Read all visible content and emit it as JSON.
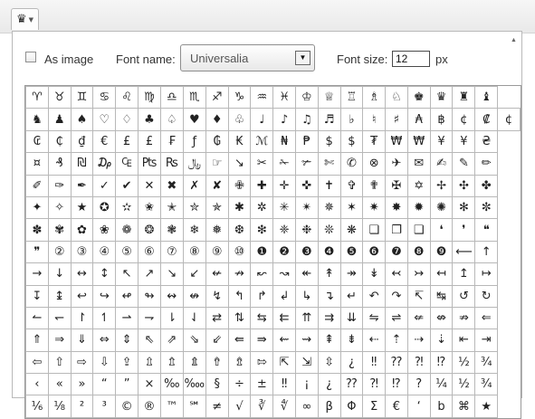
{
  "toolbar": {
    "special_char_icon": "♛",
    "dropdown_caret": "▼"
  },
  "panel": {
    "as_image_label": "As image",
    "font_name_label": "Font name:",
    "font_name_value": "Universalia",
    "font_size_label": "Font size:",
    "font_size_value": "12",
    "px_label": "px",
    "select_arrow": "▼",
    "scroll_up": "▲",
    "scroll_down": "▼"
  },
  "characters": [
    [
      "♈",
      "♉",
      "♊",
      "♋",
      "♌",
      "♍",
      "♎",
      "♏",
      "♐",
      "♑",
      "♒",
      "♓",
      "♔",
      "♕",
      "♖",
      "♗",
      "♘",
      "♚",
      "♛",
      "♜",
      "♝"
    ],
    [
      "♞",
      "♟",
      "♠",
      "♡",
      "♢",
      "♣",
      "♤",
      "♥",
      "♦",
      "♧",
      "♩",
      "♪",
      "♫",
      "♬",
      "♭",
      "♮",
      "♯",
      "₳",
      "฿",
      "¢",
      "₡",
      "¢"
    ],
    [
      "₢",
      "₵",
      "₫",
      "€",
      "£",
      "£",
      "₣",
      "ƒ",
      "₲",
      "₭",
      "ℳ",
      "₦",
      "₱",
      "$",
      "$",
      "₮",
      "₩",
      "₩",
      "¥",
      "¥",
      "₴"
    ],
    [
      "¤",
      "₰",
      "₪",
      "₯",
      "₠",
      "₧",
      "₨",
      "﷼",
      "☞",
      "↘",
      "✂",
      "✁",
      "✃",
      "✄",
      "✆",
      "⊗",
      "✈",
      "✉",
      "✍",
      "✎",
      "✏"
    ],
    [
      "✐",
      "✑",
      "✒",
      "✓",
      "✔",
      "✕",
      "✖",
      "✗",
      "✘",
      "✙",
      "✚",
      "✛",
      "✜",
      "✝",
      "✞",
      "✟",
      "✠",
      "✡",
      "✢",
      "✣",
      "✤"
    ],
    [
      "✦",
      "✧",
      "★",
      "✪",
      "✫",
      "✬",
      "✭",
      "✮",
      "✯",
      "✱",
      "✲",
      "✳",
      "✴",
      "✵",
      "✶",
      "✷",
      "✸",
      "✹",
      "✺",
      "✻",
      "✼"
    ],
    [
      "✽",
      "✾",
      "✿",
      "❀",
      "❁",
      "❂",
      "❃",
      "❄",
      "❅",
      "❆",
      "❇",
      "❈",
      "❉",
      "❊",
      "❋",
      "❏",
      "❐",
      "❑",
      "❛",
      "❜",
      "❝"
    ],
    [
      "❞",
      "②",
      "③",
      "④",
      "⑤",
      "⑥",
      "⑦",
      "⑧",
      "⑨",
      "⑩",
      "❶",
      "❷",
      "❸",
      "❹",
      "❺",
      "❻",
      "❼",
      "❽",
      "❾",
      "⟵",
      "↑"
    ],
    [
      "→",
      "↓",
      "↔",
      "↕",
      "↖",
      "↗",
      "↘",
      "↙",
      "↚",
      "↛",
      "↜",
      "↝",
      "↞",
      "↟",
      "↠",
      "↡",
      "↢",
      "↣",
      "↤",
      "↥",
      "↦"
    ],
    [
      "↧",
      "↨",
      "↩",
      "↪",
      "↫",
      "↬",
      "↭",
      "↮",
      "↯",
      "↰",
      "↱",
      "↲",
      "↳",
      "↴",
      "↵",
      "↶",
      "↷",
      "↸",
      "↹",
      "↺",
      "↻"
    ],
    [
      "↼",
      "↽",
      "↾",
      "↿",
      "⇀",
      "⇁",
      "⇂",
      "⇃",
      "⇄",
      "⇅",
      "⇆",
      "⇇",
      "⇈",
      "⇉",
      "⇊",
      "⇋",
      "⇌",
      "⇍",
      "⇎",
      "⇏",
      "⇐"
    ],
    [
      "⇑",
      "⇒",
      "⇓",
      "⇔",
      "⇕",
      "⇖",
      "⇗",
      "⇘",
      "⇙",
      "⇚",
      "⇛",
      "⇜",
      "⇝",
      "⇞",
      "⇟",
      "⇠",
      "⇡",
      "⇢",
      "⇣",
      "⇤",
      "⇥"
    ],
    [
      "⇦",
      "⇧",
      "⇨",
      "⇩",
      "⇪",
      "⇫",
      "⇬",
      "⇭",
      "⇮",
      "⇯",
      "⇰",
      "⇱",
      "⇲",
      "⇳",
      "¿",
      "‼",
      "⁇",
      "⁈",
      "⁉",
      "½",
      "¾"
    ],
    [
      "‹",
      "«",
      "»",
      "“",
      "”",
      "×",
      "‰",
      "‱",
      "§",
      "÷",
      "±",
      "‼",
      "¡",
      "¿",
      "⁇",
      "⁈",
      "⁉",
      "?",
      "¼",
      "½",
      "¾"
    ],
    [
      "⅙",
      "⅛",
      "²",
      "³",
      "©",
      "®",
      "™",
      "℠",
      "≠",
      "√",
      "∛",
      "∜",
      "∞",
      "β",
      "Φ",
      "Σ",
      "€",
      "‘",
      "b",
      "⌘",
      "★"
    ]
  ]
}
